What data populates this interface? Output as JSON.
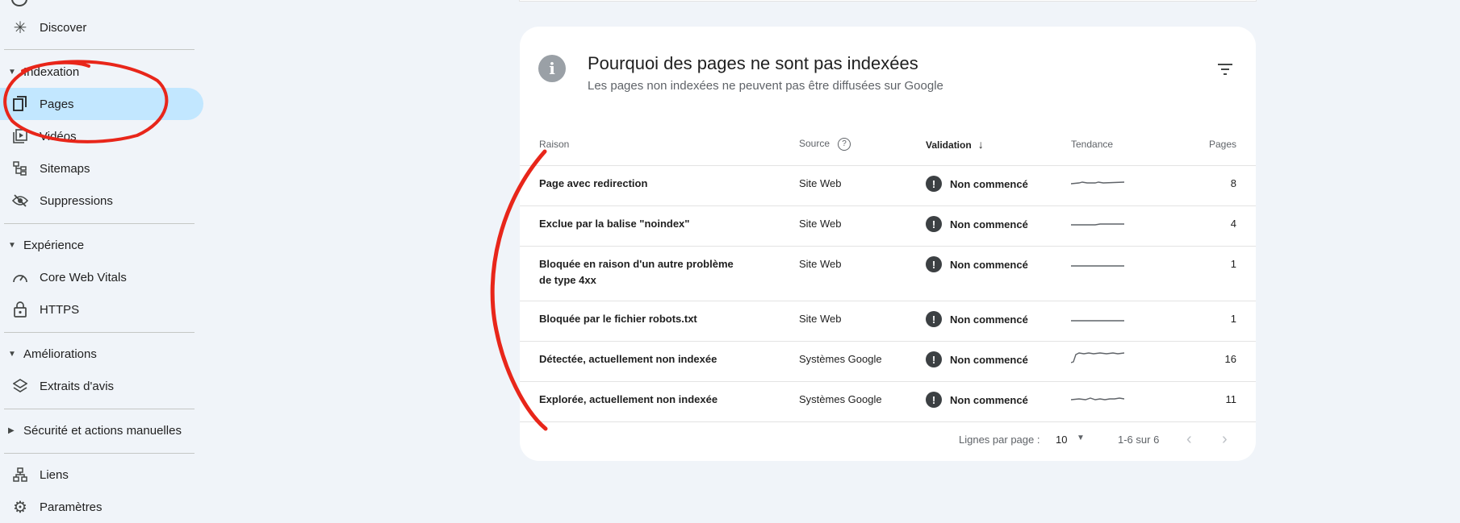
{
  "sidebar": {
    "discover": {
      "label": "Discover",
      "icon": "asterisk-icon"
    },
    "indexation": {
      "label": "Indexation",
      "items": [
        {
          "label": "Pages",
          "icon": "pages-icon",
          "active": true
        },
        {
          "label": "Vidéos",
          "icon": "video-icon"
        },
        {
          "label": "Sitemaps",
          "icon": "sitemap-icon"
        },
        {
          "label": "Suppressions",
          "icon": "eye-off-icon"
        }
      ]
    },
    "experience": {
      "label": "Expérience",
      "items": [
        {
          "label": "Core Web Vitals",
          "icon": "speedometer-icon"
        },
        {
          "label": "HTTPS",
          "icon": "lock-icon"
        }
      ]
    },
    "ameliorations": {
      "label": "Améliorations",
      "items": [
        {
          "label": "Extraits d'avis",
          "icon": "layers-icon"
        }
      ]
    },
    "securite": {
      "label": "Sécurité et actions manuelles"
    },
    "liens": {
      "label": "Liens",
      "icon": "links-icon"
    },
    "parametres": {
      "label": "Paramètres",
      "icon": "gear-icon"
    }
  },
  "card": {
    "title": "Pourquoi des pages ne sont pas indexées",
    "subtitle": "Les pages non indexées ne peuvent pas être diffusées sur Google",
    "columns": {
      "raison": "Raison",
      "source": "Source",
      "validation": "Validation",
      "tendance": "Tendance",
      "pages": "Pages"
    },
    "rows": [
      {
        "raison": "Page avec redirection",
        "source": "Site Web",
        "validation": "Non commencé",
        "pages": "8"
      },
      {
        "raison": "Exclue par la balise \"noindex\"",
        "source": "Site Web",
        "validation": "Non commencé",
        "pages": "4"
      },
      {
        "raison": "Bloquée en raison d'un autre problème de type 4xx",
        "source": "Site Web",
        "validation": "Non commencé",
        "pages": "1"
      },
      {
        "raison": "Bloquée par le fichier robots.txt",
        "source": "Site Web",
        "validation": "Non commencé",
        "pages": "1"
      },
      {
        "raison": "Détectée, actuellement non indexée",
        "source": "Systèmes Google",
        "validation": "Non commencé",
        "pages": "16"
      },
      {
        "raison": "Explorée, actuellement non indexée",
        "source": "Systèmes Google",
        "validation": "Non commencé",
        "pages": "11"
      }
    ],
    "footer": {
      "rows_per_page_label": "Lignes par page :",
      "rows_per_page": "10",
      "range": "1-6 sur 6"
    }
  },
  "colors": {
    "accent_active": "#c2e7ff",
    "annotation": "#e8261a",
    "background": "#f0f4f9"
  }
}
